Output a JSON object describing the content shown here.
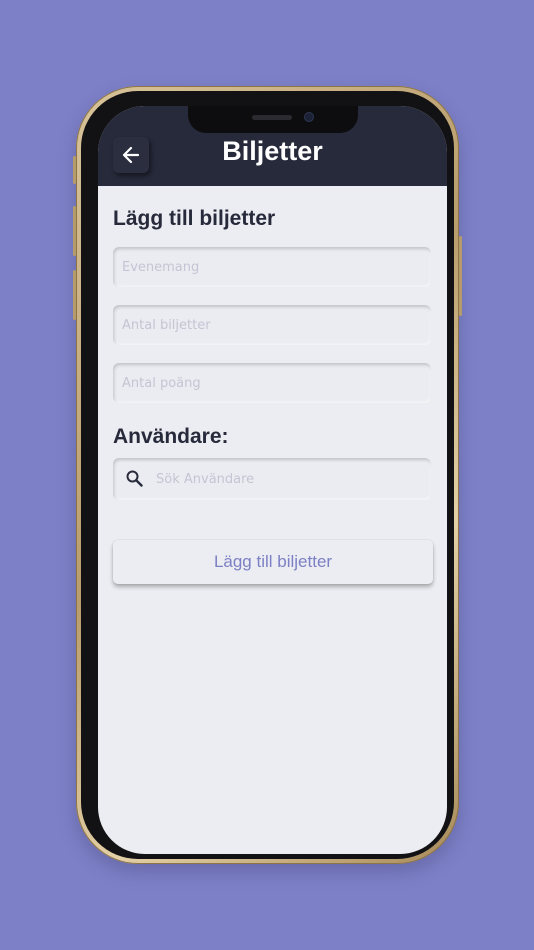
{
  "header": {
    "title": "Biljetter",
    "back_icon": "arrow-left-icon"
  },
  "form": {
    "section_title": "Lägg till biljetter",
    "event_placeholder": "Evenemang",
    "tickets_placeholder": "Antal biljetter",
    "points_placeholder": "Antal poäng"
  },
  "users": {
    "section_title": "Användare:",
    "search_placeholder": "Sök Användare",
    "search_icon": "search-icon"
  },
  "actions": {
    "submit_label": "Lägg till biljetter"
  },
  "colors": {
    "background": "#7d80c7",
    "header": "#262a3a",
    "screen": "#ecedf2",
    "accent": "#7c80c4"
  }
}
